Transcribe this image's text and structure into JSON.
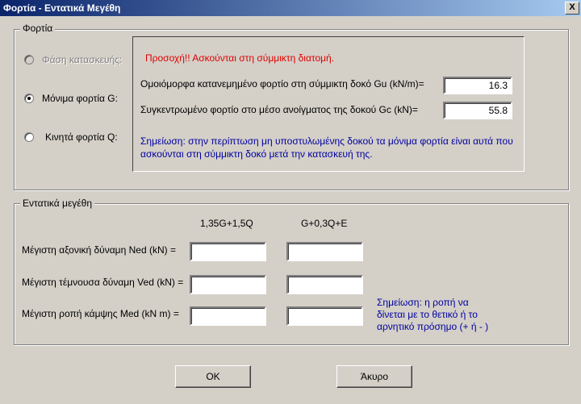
{
  "window": {
    "title": "Φορτία - Εντατικά Μεγέθη",
    "close_label": "X"
  },
  "loads_group": {
    "legend": "Φορτία",
    "radios": [
      {
        "label": "Φάση κατασκευής:",
        "checked": false,
        "disabled": true
      },
      {
        "label": "Μόνιμα φορτία G:",
        "checked": true,
        "disabled": false
      },
      {
        "label": "Κινητά φορτία Q:",
        "checked": false,
        "disabled": false
      }
    ],
    "warning": "Προσοχή!! Ασκούνται στη σύμμικτη διατομή.",
    "gu_label": "Ομοιόμορφα κατανεμημένο φορτίο στη σύμμικτη δοκό Gu (kN/m)=",
    "gu_value": "16.3",
    "gc_label": "Συγκεντρωμένο φορτίο στο μέσο ανοίγματος της δοκού Gc (kN)=",
    "gc_value": "55.8",
    "note_line1": "Σημείωση: στην περίπτωση μη υποστυλωμένης δοκού τα μόνιμα φορτία είναι αυτά που",
    "note_line2": "ασκούνται στη σύμμικτη δοκό μετά την κατασκευή της."
  },
  "forces_group": {
    "legend": "Εντατικά μεγέθη",
    "col1_header": "1,35G+1,5Q",
    "col2_header": "G+0,3Q+E",
    "rows": [
      {
        "label": "Μέγιστη αξονική δύναμη Ned (kN) =",
        "v1": "",
        "v2": ""
      },
      {
        "label": "Μέγιστη τέμνουσα δύναμη Ved (kN) =",
        "v1": "",
        "v2": ""
      },
      {
        "label": "Μέγιστη ροπή κάμψης Med (kN m) =",
        "v1": "",
        "v2": ""
      }
    ],
    "note_line1": "Σημείωση: η ροπή να",
    "note_line2": "δίνεται με το θετικό ή το",
    "note_line3": "αρνητικό πρόσημο (+ ή - )"
  },
  "buttons": {
    "ok": "OK",
    "cancel": "Άκυρο"
  }
}
